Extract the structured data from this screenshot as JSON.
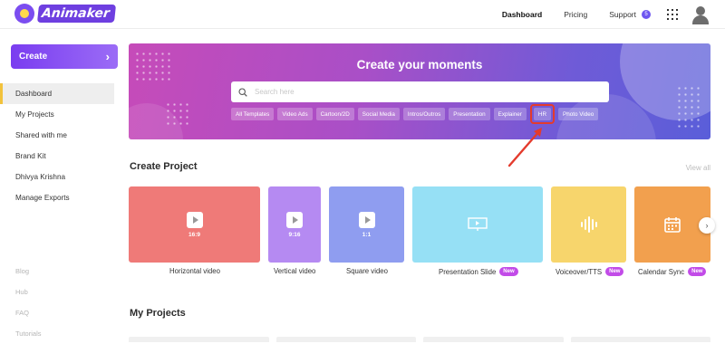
{
  "app": {
    "logo_text": "Animaker"
  },
  "nav": {
    "links": [
      "Dashboard",
      "Pricing",
      "Support"
    ],
    "active": "Dashboard",
    "notification_count": "5"
  },
  "sidebar": {
    "create_label": "Create",
    "items": [
      {
        "label": "Dashboard",
        "active": true
      },
      {
        "label": "My Projects"
      },
      {
        "label": "Shared with me"
      },
      {
        "label": "Brand Kit"
      },
      {
        "label": "Dhivya Krishna"
      },
      {
        "label": "Manage Exports"
      }
    ],
    "footer": [
      "Blog",
      "Hub",
      "FAQ",
      "Tutorials"
    ]
  },
  "hero": {
    "title": "Create your moments",
    "search_placeholder": "Search here",
    "chips": [
      "All Templates",
      "Video Ads",
      "Cartoon/2D",
      "Social Media",
      "Intros/Outros",
      "Presentation",
      "Explainer",
      "HR",
      "Photo Video"
    ],
    "highlighted_chip": "HR"
  },
  "create_project": {
    "title": "Create Project",
    "view_all": "View all",
    "cards": [
      {
        "label": "Horizontal video",
        "ratio": "16:9",
        "color": "#ef7a78",
        "icon": "play-icon"
      },
      {
        "label": "Vertical video",
        "ratio": "9:16",
        "color": "#b58af2",
        "icon": "play-icon"
      },
      {
        "label": "Square video",
        "ratio": "1:1",
        "color": "#8f9df0",
        "icon": "play-icon"
      },
      {
        "label": "Presentation Slide",
        "badge": "New",
        "color": "#96e0f5",
        "icon": "presentation-icon"
      },
      {
        "label": "Voiceover/TTS",
        "badge": "New",
        "color": "#f7d56c",
        "icon": "sound-wave-icon"
      },
      {
        "label": "Calendar Sync",
        "badge": "New",
        "color": "#f2a04e",
        "icon": "calendar-icon"
      }
    ]
  },
  "my_projects": {
    "title": "My Projects"
  }
}
